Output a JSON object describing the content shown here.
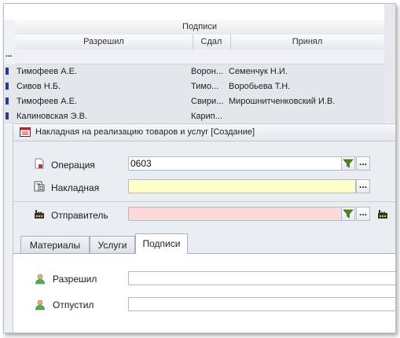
{
  "grid": {
    "group_header": "Подписи",
    "columns": [
      "Разрешил",
      "Сдал",
      "Принял"
    ],
    "filter_placeholder": "...",
    "rows": [
      {
        "razreshil": "Тимофеев А.Е.",
        "sdal": "Ворон...",
        "prinyal": "Семенчук Н.И."
      },
      {
        "razreshil": "Сивов Н.Б.",
        "sdal": "Тимо...",
        "prinyal": "Воробьева Т.Н."
      },
      {
        "razreshil": "Тимофеев А.Е.",
        "sdal": "Свири...",
        "prinyal": "Мирошнитченковский И.В."
      },
      {
        "razreshil": "Калиновская Э.В.",
        "sdal": "Карип...",
        "prinyal": ""
      }
    ]
  },
  "document": {
    "title": "Накладная на реализацию товаров и услуг [Создание]",
    "fields": {
      "operation": {
        "label": "Операция",
        "value": "0603"
      },
      "invoice": {
        "label": "Накладная",
        "value": ""
      },
      "sender": {
        "label": "Отправитель",
        "value": ""
      }
    },
    "button_ellipsis": "...",
    "tabs": [
      "Материалы",
      "Услуги",
      "Подписи"
    ],
    "active_tab": "Подписи",
    "signatures": {
      "approved": {
        "label": "Разрешил",
        "value": ""
      },
      "released": {
        "label": "Отпустил",
        "value": ""
      }
    }
  },
  "colors": {
    "invoice_bg": "#ffffcc",
    "sender_bg": "#fadadb",
    "row_bg": "#e3e6ea",
    "row_marker": "#2a3b8f"
  },
  "icons": {
    "title": "document-red-icon",
    "operation": "document-icon",
    "invoice": "calculator-document-icon",
    "sender": "factory-icon",
    "person": "user-icon",
    "filter": "filter-funnel-icon"
  }
}
